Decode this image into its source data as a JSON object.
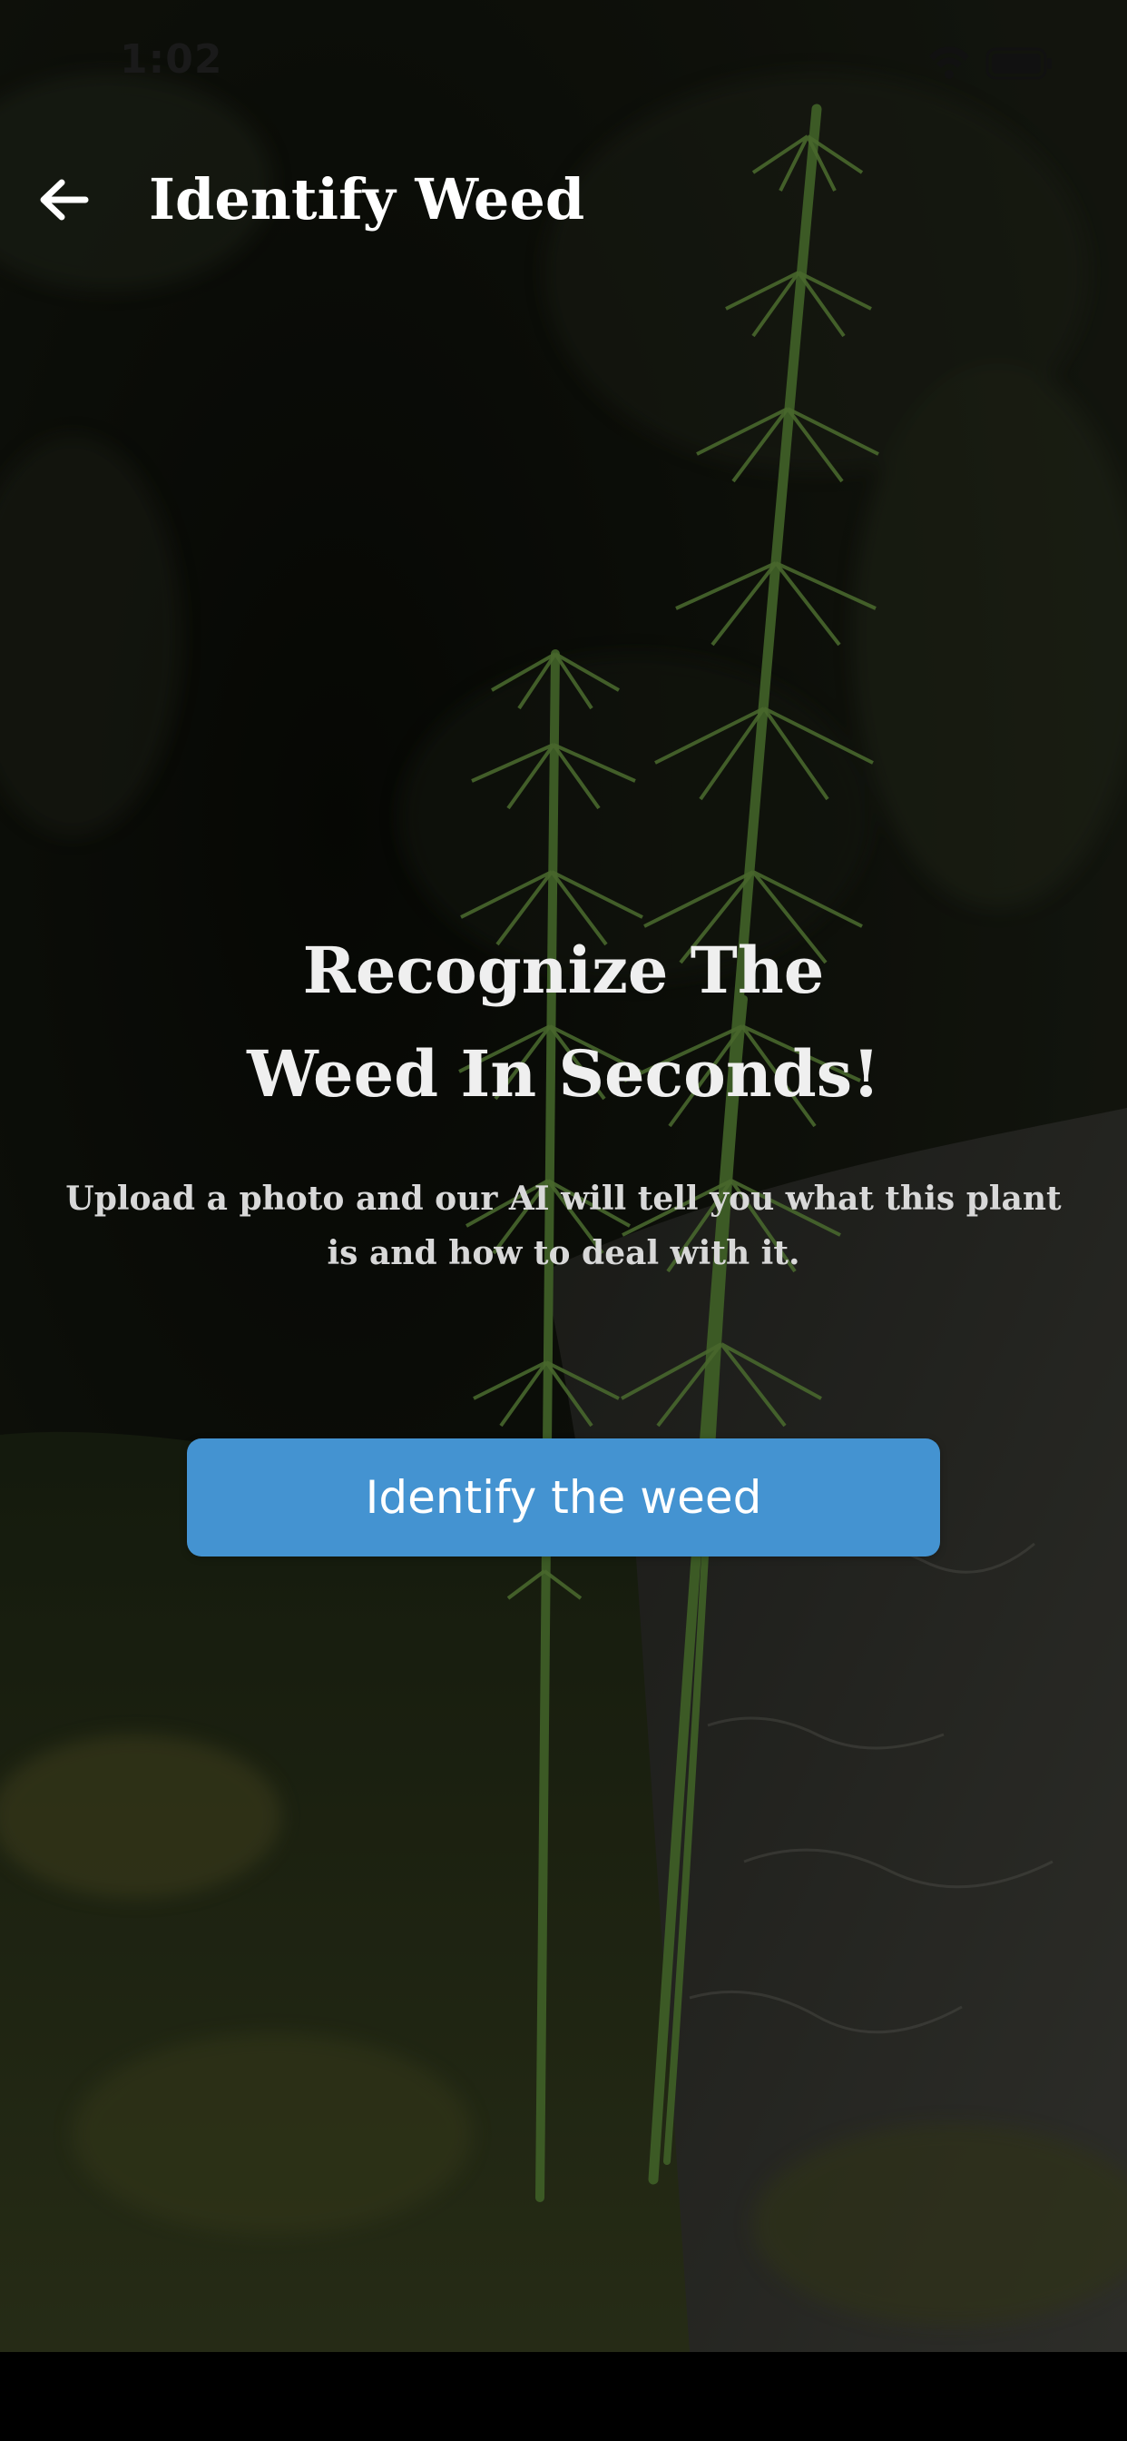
{
  "status_bar": {
    "time": "1:02"
  },
  "header": {
    "title": "Identify Weed",
    "back_icon": "arrow-left-icon"
  },
  "hero": {
    "heading_lines": [
      "Recognize The",
      "Weed In Seconds!"
    ],
    "subtitle_lines": [
      "Upload a photo and our AI will tell you what this plant",
      "is and how to deal with it."
    ]
  },
  "cta": {
    "label": "Identify the weed"
  },
  "colors": {
    "accent": "#4493d1",
    "title_text": "#ffffff",
    "heading_text": "#efefef",
    "subtitle_text": "#d8d8d8"
  }
}
